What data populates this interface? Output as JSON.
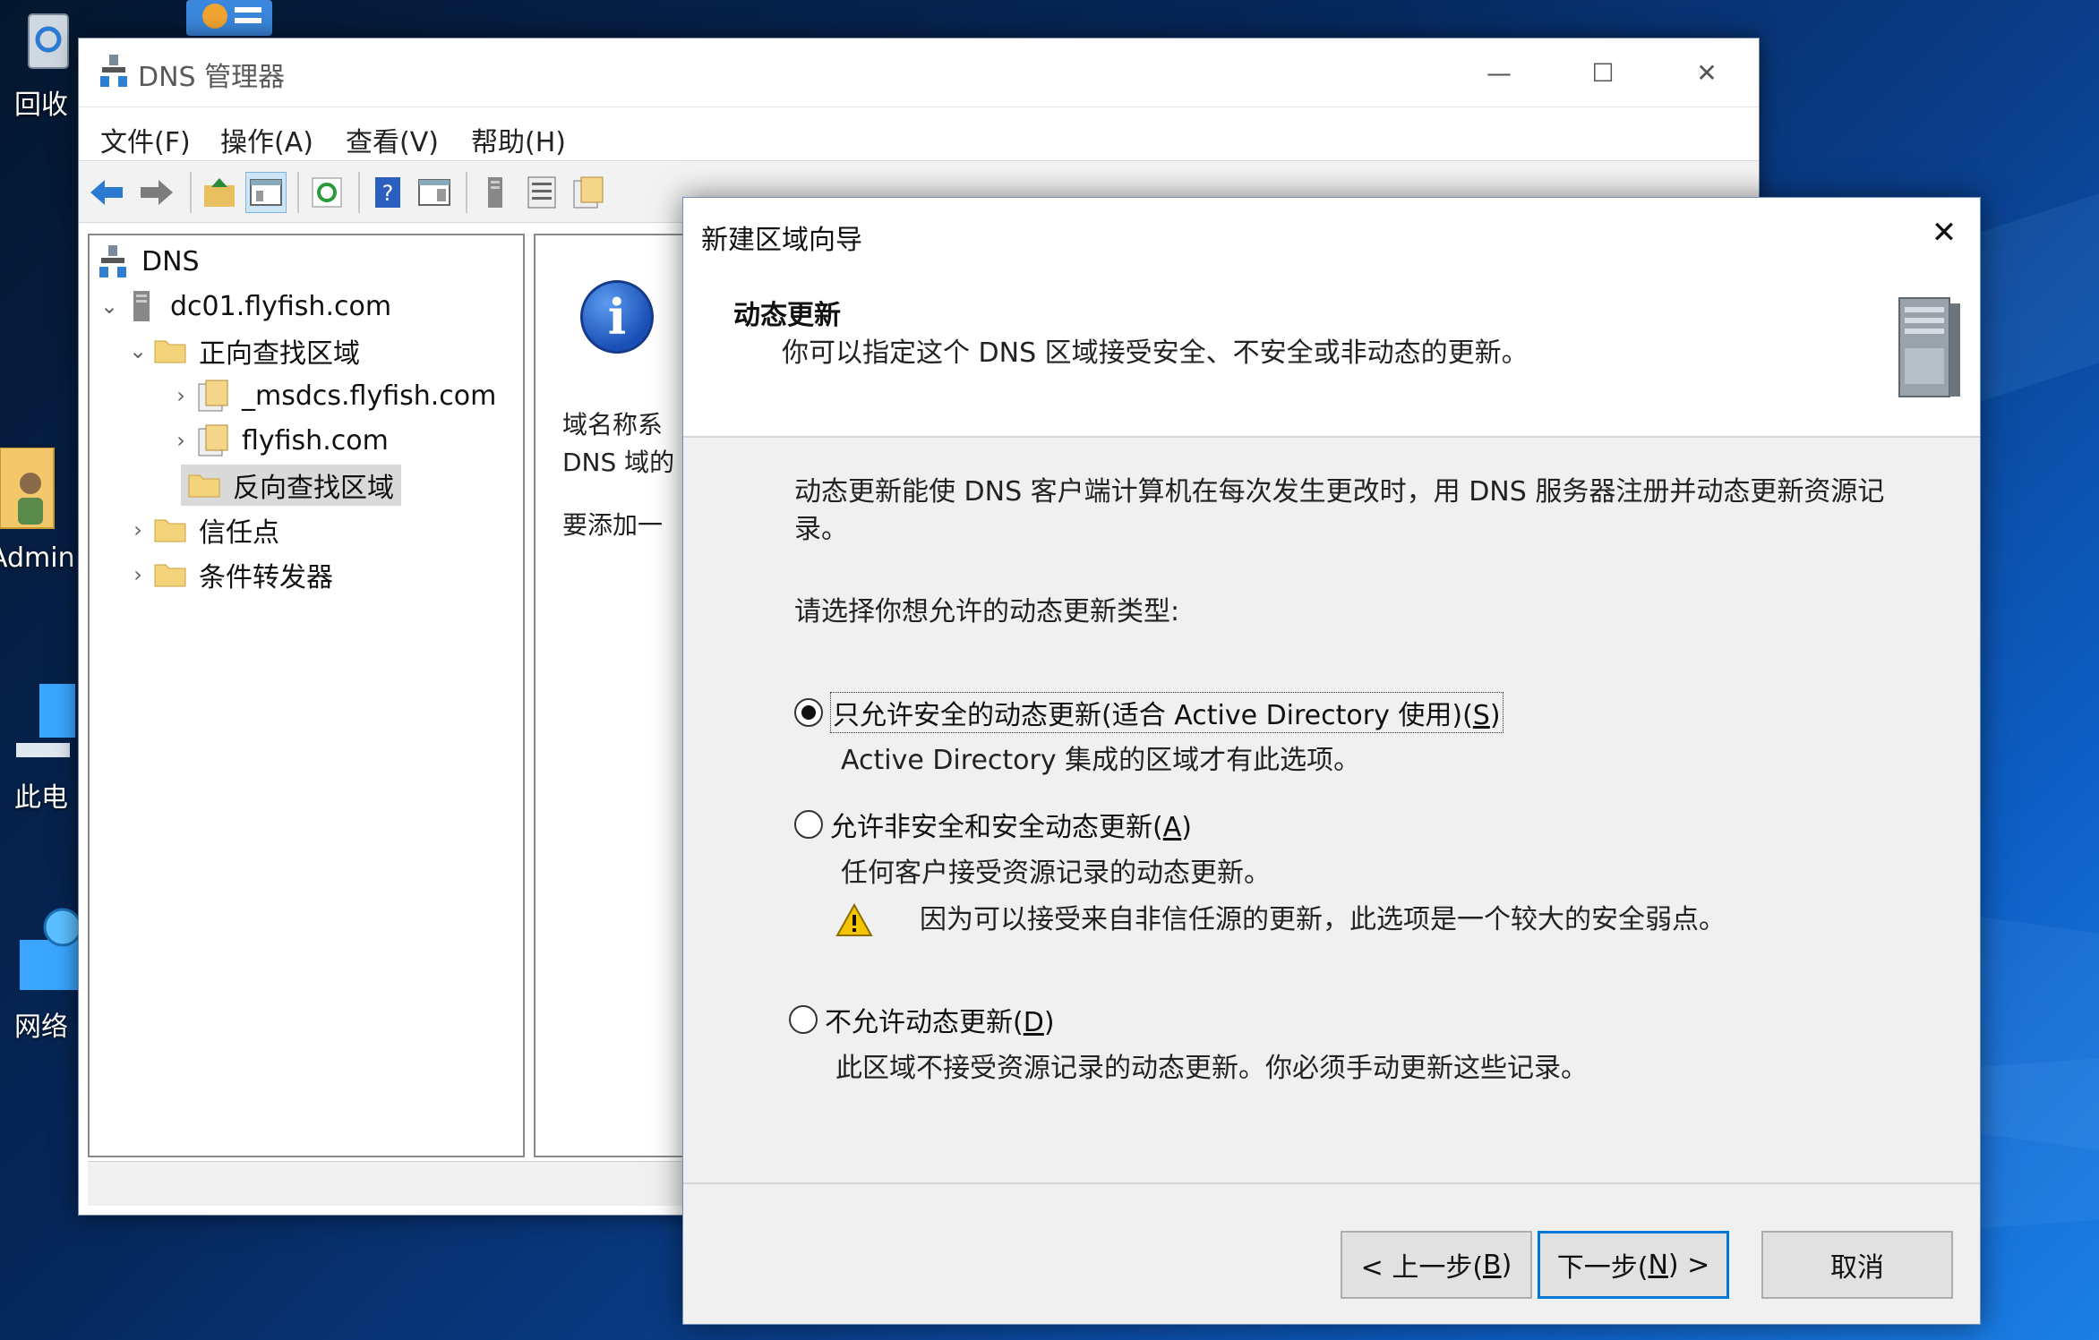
{
  "desktop": {
    "icons": [
      {
        "label": "回收"
      },
      {
        "label": "Admin"
      },
      {
        "label": "此电"
      },
      {
        "label": "网络"
      }
    ]
  },
  "dns_window": {
    "title": "DNS 管理器",
    "controls": {
      "minimize": "—",
      "maximize": "☐",
      "close": "✕"
    },
    "menu": [
      "文件(F)",
      "操作(A)",
      "查看(V)",
      "帮助(H)"
    ],
    "tree": [
      {
        "label": "DNS"
      },
      {
        "label": "dc01.flyfish.com"
      },
      {
        "label": "正向查找区域"
      },
      {
        "label": "_msdcs.flyfish.com"
      },
      {
        "label": "flyfish.com"
      },
      {
        "label": "反向查找区域"
      },
      {
        "label": "信任点"
      },
      {
        "label": "条件转发器"
      }
    ],
    "right_pane": {
      "line1": "域名称系",
      "line2": "DNS 域的",
      "line3": "要添加一"
    }
  },
  "wizard": {
    "title": "新建区域向导",
    "close": "✕",
    "header_title": "动态更新",
    "header_subtitle": "你可以指定这个 DNS 区域接受安全、不安全或非动态的更新。",
    "description_line1": "动态更新能使 DNS 客户端计算机在每次发生更改时，用 DNS 服务器注册并动态更新资源记",
    "description_line2": "录。",
    "prompt": "请选择你想允许的动态更新类型:",
    "options": [
      {
        "label_prefix": "只允许安全的动态更新(适合 Active Directory 使用)(",
        "hotkey": "S",
        "label_suffix": ")",
        "selected": true,
        "description": "Active Directory 集成的区域才有此选项。"
      },
      {
        "label_prefix": "允许非安全和安全动态更新(",
        "hotkey": "A",
        "label_suffix": ")",
        "selected": false,
        "description": "任何客户接受资源记录的动态更新。",
        "warning": "因为可以接受来自非信任源的更新，此选项是一个较大的安全弱点。"
      },
      {
        "label_prefix": "不允许动态更新(",
        "hotkey": "D",
        "label_suffix": ")",
        "selected": false,
        "description": "此区域不接受资源记录的动态更新。你必须手动更新这些记录。"
      }
    ],
    "buttons": {
      "back_prefix": "< 上一步(",
      "back_hotkey": "B",
      "back_suffix": ")",
      "next_prefix": "下一步(",
      "next_hotkey": "N",
      "next_suffix": ") >",
      "cancel": "取消"
    }
  },
  "colors": {
    "accent": "#0078d7",
    "selection": "#d9d9d9",
    "warning": "#f5c400"
  }
}
